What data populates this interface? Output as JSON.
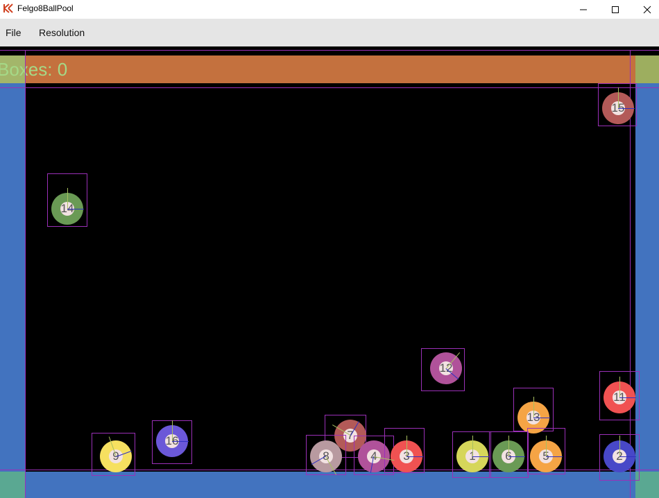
{
  "window": {
    "title": "Felgo8BallPool",
    "controls": {
      "minimize": "—",
      "maximize": "☐",
      "close": "✕"
    }
  },
  "menu": {
    "file": "File",
    "resolution": "Resolution"
  },
  "hud": {
    "boxes_label": "Boxes: 0"
  },
  "colors": {
    "wall": "#4273bf",
    "hud_bar": "#c4713e",
    "hud_text": "#a5d987",
    "debug_outline": "#9b30b8"
  },
  "balls": [
    {
      "number": "15",
      "color": "#b35a58"
    },
    {
      "number": "14",
      "color": "#6a9a55"
    },
    {
      "number": "12",
      "color": "#b0529a"
    },
    {
      "number": "11",
      "color": "#f05252"
    },
    {
      "number": "13",
      "color": "#f5a445"
    },
    {
      "number": "16",
      "color": "#6b58d8"
    },
    {
      "number": "9",
      "color": "#f6e060"
    },
    {
      "number": "7",
      "color": "#b35a58"
    },
    {
      "number": "8",
      "color": "#b89aa0"
    },
    {
      "number": "4",
      "color": "#b0529a"
    },
    {
      "number": "3",
      "color": "#f05252"
    },
    {
      "number": "1",
      "color": "#d6d65a"
    },
    {
      "number": "6",
      "color": "#6a9a55"
    },
    {
      "number": "5",
      "color": "#f5a445"
    },
    {
      "number": "2",
      "color": "#4848c8"
    }
  ]
}
